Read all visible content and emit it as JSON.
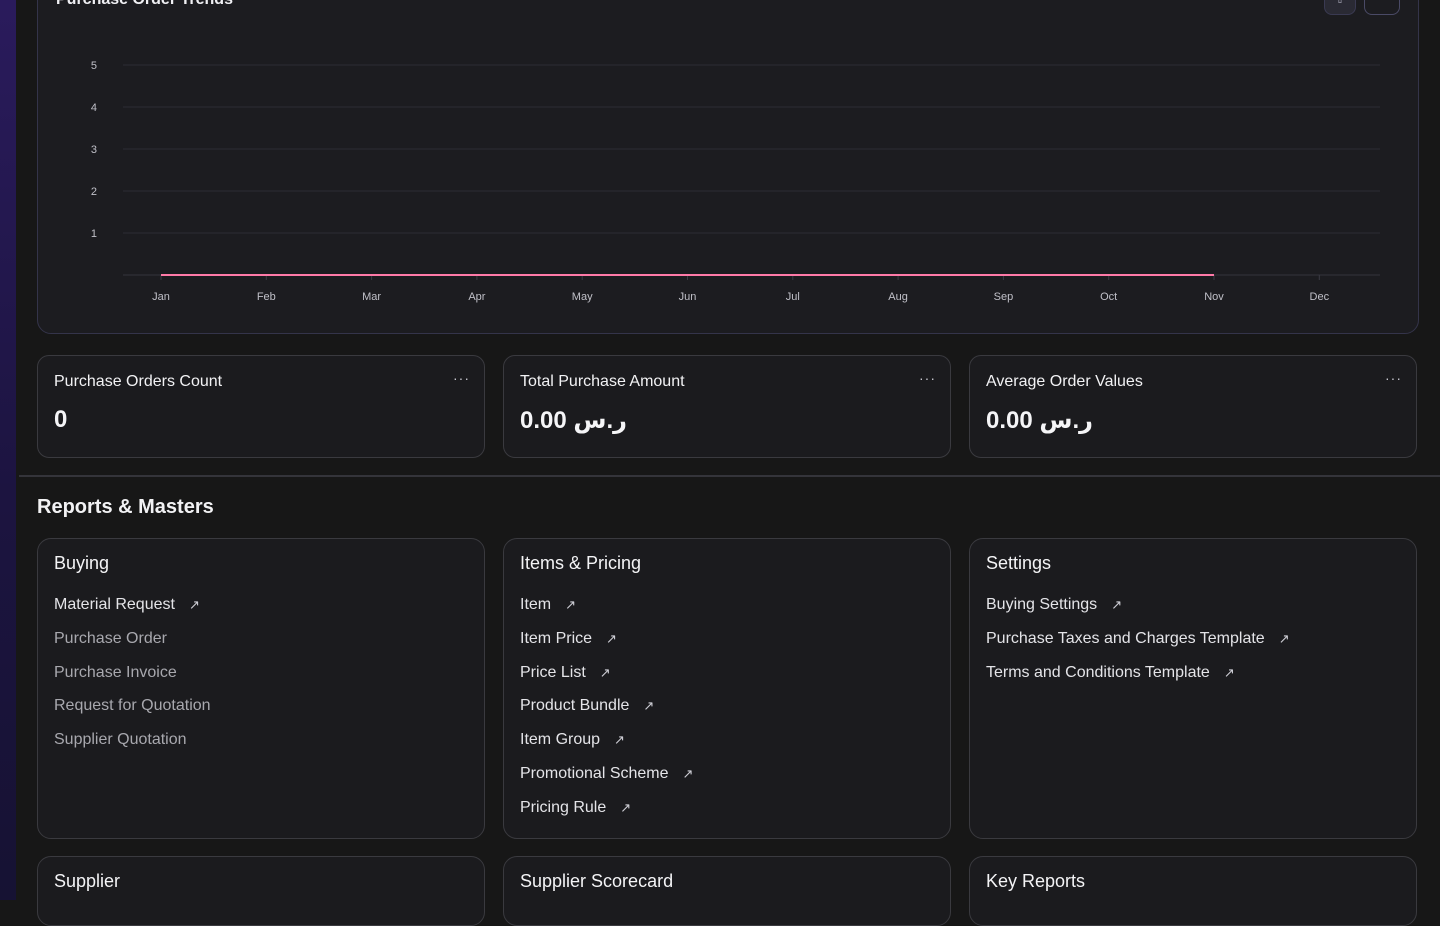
{
  "chart": {
    "title": "Purchase Order Trends",
    "buttons": [
      "⇧",
      "⋯"
    ],
    "y_ticks": [
      "1",
      "2",
      "3",
      "4",
      "5"
    ],
    "x_ticks": [
      "Jan",
      "Feb",
      "Mar",
      "Apr",
      "May",
      "Jun",
      "Jul",
      "Aug",
      "Sep",
      "Oct",
      "Nov",
      "Dec"
    ],
    "line_color": "#ff7aa8"
  },
  "chart_data": {
    "type": "line",
    "title": "Purchase Order Trends",
    "categories": [
      "Jan",
      "Feb",
      "Mar",
      "Apr",
      "May",
      "Jun",
      "Jul",
      "Aug",
      "Sep",
      "Oct",
      "Nov"
    ],
    "x_axis_ticks": [
      "Jan",
      "Feb",
      "Mar",
      "Apr",
      "May",
      "Jun",
      "Jul",
      "Aug",
      "Sep",
      "Oct",
      "Nov",
      "Dec"
    ],
    "series": [
      {
        "values": [
          0,
          0,
          0,
          0,
          0,
          0,
          0,
          0,
          0,
          0,
          0
        ]
      }
    ],
    "ylim": [
      0,
      5
    ],
    "y_ticks": [
      1,
      2,
      3,
      4,
      5
    ],
    "grid": true
  },
  "stats": [
    {
      "title": "Purchase Orders Count",
      "value": "0",
      "menu": "···"
    },
    {
      "title": "Total Purchase Amount",
      "value": "0.00 ر.س",
      "menu": "···"
    },
    {
      "title": "Average Order Values",
      "value": "0.00 ر.س",
      "menu": "···"
    }
  ],
  "section": {
    "title": "Reports & Masters"
  },
  "cards": [
    {
      "heading": "Buying",
      "links": [
        {
          "label": "Material Request",
          "arrow": "↗",
          "muted": false
        },
        {
          "label": "Purchase Order",
          "arrow": "",
          "muted": true
        },
        {
          "label": "Purchase Invoice",
          "arrow": "",
          "muted": true
        },
        {
          "label": "Request for Quotation",
          "arrow": "",
          "muted": true
        },
        {
          "label": "Supplier Quotation",
          "arrow": "",
          "muted": true
        }
      ]
    },
    {
      "heading": "Items & Pricing",
      "links": [
        {
          "label": "Item",
          "arrow": "↗",
          "muted": false
        },
        {
          "label": "Item Price",
          "arrow": "↗",
          "muted": false
        },
        {
          "label": "Price List",
          "arrow": "↗",
          "muted": false
        },
        {
          "label": "Product Bundle",
          "arrow": "↗",
          "muted": false
        },
        {
          "label": "Item Group",
          "arrow": "↗",
          "muted": false
        },
        {
          "label": "Promotional Scheme",
          "arrow": "↗",
          "muted": false
        },
        {
          "label": "Pricing Rule",
          "arrow": "↗",
          "muted": false
        }
      ]
    },
    {
      "heading": "Settings",
      "links": [
        {
          "label": "Buying Settings",
          "arrow": "↗",
          "muted": false
        },
        {
          "label": "Purchase Taxes and Charges Template",
          "arrow": "↗",
          "muted": false
        },
        {
          "label": "Terms and Conditions Template",
          "arrow": "↗",
          "muted": false
        }
      ]
    }
  ],
  "bottom_cards": [
    {
      "heading": "Supplier"
    },
    {
      "heading": "Supplier Scorecard"
    },
    {
      "heading": "Key Reports"
    }
  ]
}
